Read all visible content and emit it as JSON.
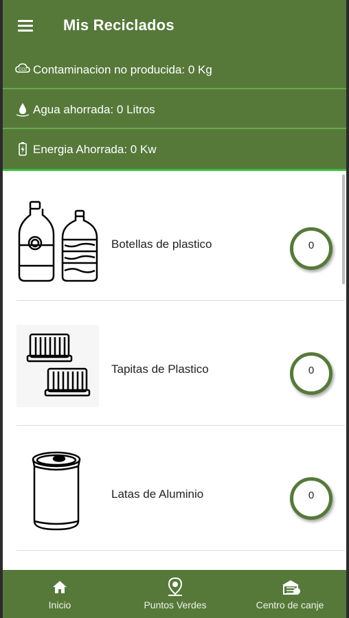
{
  "appbar": {
    "title": "Mis Reciclados",
    "menu_icon": "hamburger-menu-icon"
  },
  "stats": [
    {
      "icon": "co2-cloud-icon",
      "text": "Contaminacion no producida: 0 Kg"
    },
    {
      "icon": "water-drop-icon",
      "text": "Agua ahorrada: 0 Litros"
    },
    {
      "icon": "battery-icon",
      "text": "Energia Ahorrada: 0 Kw"
    }
  ],
  "items": [
    {
      "icon": "plastic-bottles-icon",
      "label": "Botellas de plastico",
      "count": "0"
    },
    {
      "icon": "plastic-caps-icon",
      "label": "Tapitas de Plastico",
      "count": "0"
    },
    {
      "icon": "aluminum-can-icon",
      "label": "Latas de Aluminio",
      "count": "0"
    }
  ],
  "bottom_nav": [
    {
      "icon": "home-icon",
      "label": "Inicio"
    },
    {
      "icon": "map-pin-icon",
      "label": "Puntos Verdes"
    },
    {
      "icon": "exchange-center-icon",
      "label": "Centro de canje"
    }
  ],
  "colors": {
    "primary": "#56793a",
    "divider": "#6aa84f"
  }
}
